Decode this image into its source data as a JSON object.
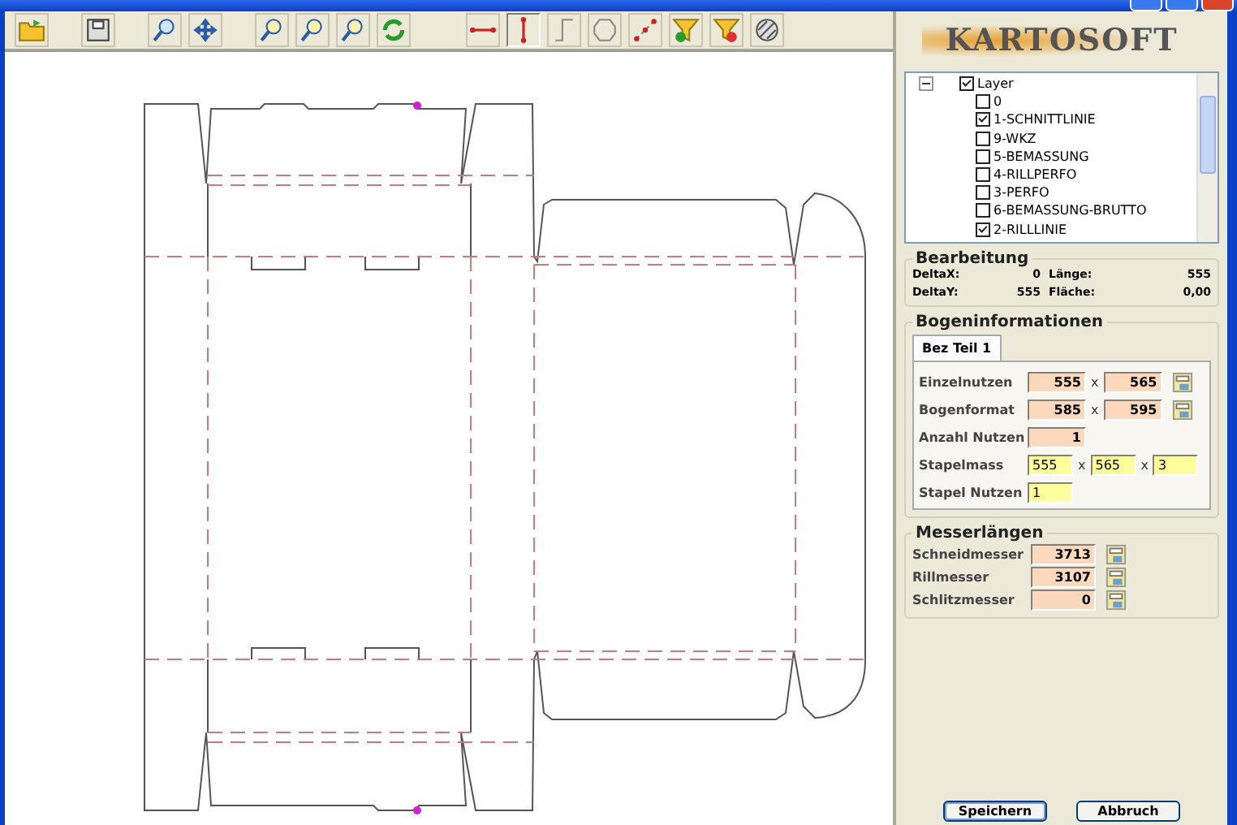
{
  "logo": "KARTOSOFT",
  "layers": {
    "label": "Layer",
    "checked": true,
    "expanded": true,
    "children": [
      {
        "label": "0",
        "checked": false
      },
      {
        "label": "1-SCHNITTLINIE",
        "checked": true
      },
      {
        "label": "9-WKZ",
        "checked": false
      },
      {
        "label": "5-BEMASSUNG",
        "checked": false
      },
      {
        "label": "4-RILLPERFO",
        "checked": false
      },
      {
        "label": "3-PERFO",
        "checked": false
      },
      {
        "label": "6-BEMASSUNG-BRUTTO",
        "checked": false
      },
      {
        "label": "2-RILLLINIE",
        "checked": true
      }
    ]
  },
  "bearbeitung": {
    "title": "Bearbeitung",
    "items": [
      {
        "label": "DeltaX:",
        "value": "0"
      },
      {
        "label": "Länge:",
        "value": "555"
      },
      {
        "label": "DeltaY:",
        "value": "555"
      },
      {
        "label": "Fläche:",
        "value": "0,00"
      }
    ]
  },
  "bogeninformationen": {
    "title": "Bogeninformationen",
    "tabs": [
      {
        "label": "Bez Teil 1",
        "selected": true
      }
    ],
    "rows": [
      {
        "label": "Einzelnutzen",
        "editable": false,
        "calc_button": true,
        "fields": [
          {
            "value": "555"
          },
          {
            "separator": "x",
            "value": "565"
          }
        ]
      },
      {
        "label": "Bogenformat",
        "editable": false,
        "calc_button": true,
        "fields": [
          {
            "value": "585"
          },
          {
            "separator": "x",
            "value": "595"
          }
        ]
      },
      {
        "label": "Anzahl Nutzen",
        "editable": false,
        "calc_button": false,
        "fields": [
          {
            "value": "1"
          }
        ]
      },
      {
        "label": "Stapelmass",
        "editable": true,
        "calc_button": false,
        "fields": [
          {
            "value": "555"
          },
          {
            "separator": "x",
            "value": "565"
          },
          {
            "separator": "x",
            "value": "3"
          }
        ]
      },
      {
        "label": "Stapel Nutzen",
        "editable": true,
        "calc_button": false,
        "fields": [
          {
            "value": "1"
          }
        ]
      }
    ]
  },
  "messerlaengen": {
    "title": "Messerlängen",
    "rows": [
      {
        "label": "Schneidmesser",
        "value": "3713"
      },
      {
        "label": "Rillmesser",
        "value": "3107"
      },
      {
        "label": "Schlitzmesser",
        "value": "0"
      }
    ]
  },
  "buttons": [
    {
      "label": "Speichern",
      "default": true
    },
    {
      "label": "Abbruch",
      "default": false
    }
  ]
}
